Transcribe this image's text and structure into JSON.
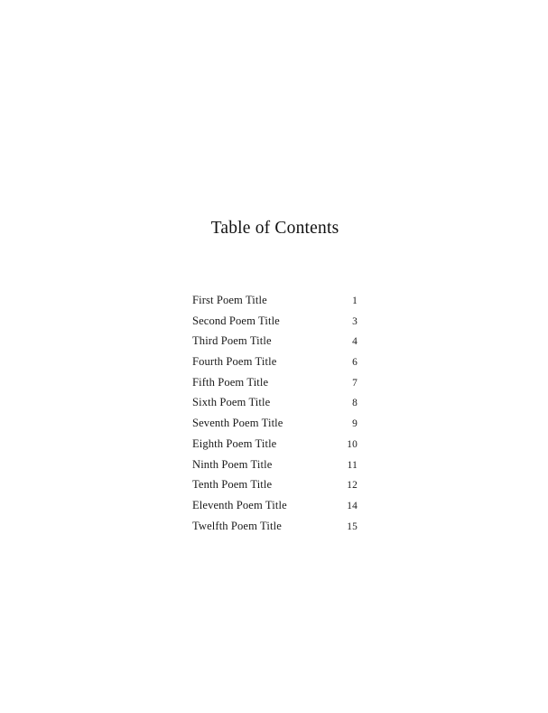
{
  "document": {
    "heading": "Table of Contents",
    "background_color": "#ffffff",
    "text_color": "#1a1a1a"
  },
  "toc": {
    "entries": [
      {
        "title": "First Poem Title",
        "page": "1"
      },
      {
        "title": "Second Poem Title",
        "page": "3"
      },
      {
        "title": "Third Poem Title",
        "page": "4"
      },
      {
        "title": "Fourth Poem Title",
        "page": "6"
      },
      {
        "title": "Fifth Poem Title",
        "page": "7"
      },
      {
        "title": "Sixth Poem Title",
        "page": "8"
      },
      {
        "title": "Seventh Poem Title",
        "page": "9"
      },
      {
        "title": "Eighth Poem Title",
        "page": "10"
      },
      {
        "title": "Ninth Poem Title",
        "page": "11"
      },
      {
        "title": "Tenth Poem Title",
        "page": "12"
      },
      {
        "title": "Eleventh Poem Title",
        "page": "14"
      },
      {
        "title": "Twelfth Poem Title",
        "page": "15"
      }
    ]
  }
}
